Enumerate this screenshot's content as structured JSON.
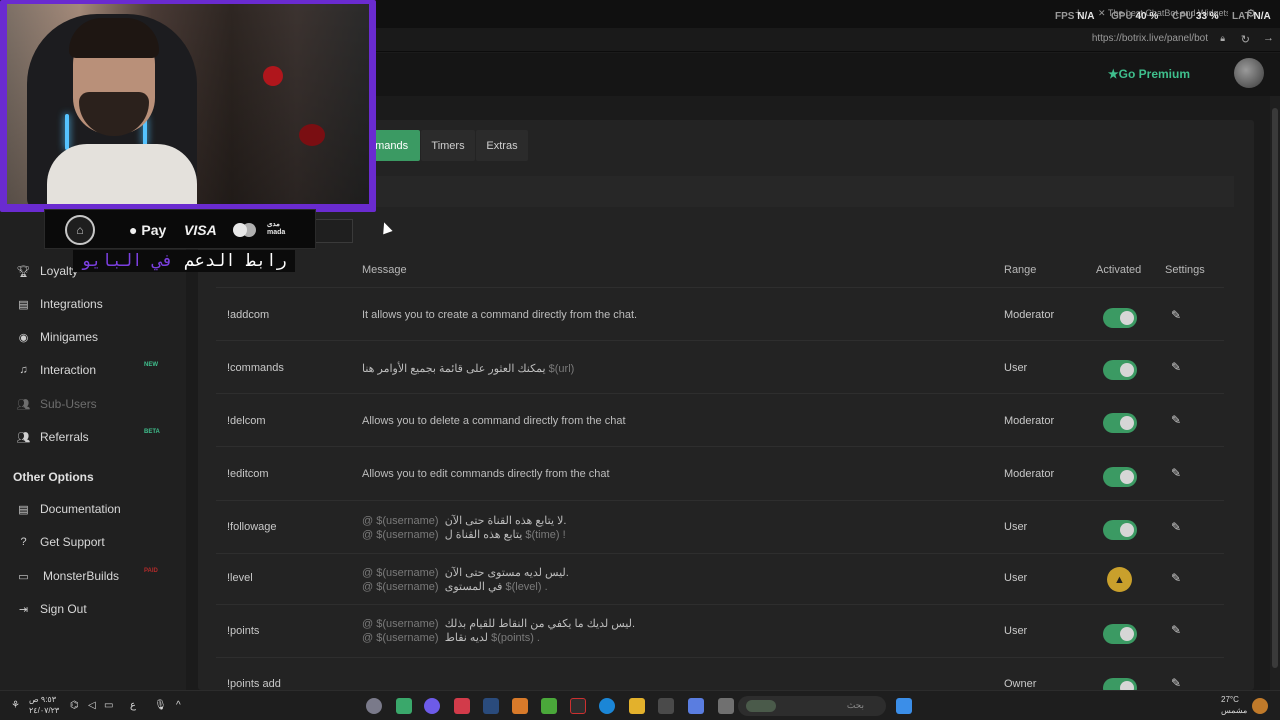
{
  "browser": {
    "tab_title": "The best ChatBot and Widgets fo",
    "url": "https://botrix.live/panel/bot",
    "stats": [
      {
        "label": "FPS",
        "value": "N/A"
      },
      {
        "label": "GPU",
        "value": "40 %"
      },
      {
        "label": "CPU",
        "value": "33 %"
      },
      {
        "label": "LAT",
        "value": "N/A"
      }
    ]
  },
  "header": {
    "go_premium": "Go Premium"
  },
  "sidebar": {
    "items": [
      {
        "label": "Loyalty",
        "icon": "trophy-icon"
      },
      {
        "label": "Integrations",
        "icon": "integrations-icon"
      },
      {
        "label": "Minigames",
        "icon": "gamepad-icon"
      },
      {
        "label": "Interaction",
        "icon": "music-icon",
        "badge": "NEW"
      },
      {
        "label": "Sub-Users",
        "icon": "users-icon"
      },
      {
        "label": "Referrals",
        "icon": "referrals-icon",
        "badge": "BETA"
      }
    ],
    "other_options_heading": "Other Options",
    "other_items": [
      {
        "label": "Documentation",
        "icon": "book-icon"
      },
      {
        "label": "Get Support",
        "icon": "help-icon"
      },
      {
        "label": "MonsterBuilds",
        "icon": "laptop-icon",
        "badge": "PAID"
      },
      {
        "label": "Sign Out",
        "icon": "sign-out-icon"
      }
    ]
  },
  "tabs": [
    {
      "label": "Commands",
      "active": true
    },
    {
      "label": "Timers",
      "active": false
    },
    {
      "label": "Extras",
      "active": false
    }
  ],
  "table": {
    "headers": {
      "message": "Message",
      "range": "Range",
      "activated": "Activated",
      "settings": "Settings"
    },
    "rows": [
      {
        "command": "!addcom",
        "message": "It allows you to create a command directly from the chat.",
        "range": "Moderator",
        "status": "on"
      },
      {
        "command": "!commands",
        "message": "يمكنك العثور على قائمة بجميع الأوامر هنا",
        "message_var": "$(url)",
        "range": "User",
        "status": "on"
      },
      {
        "command": "!delcom",
        "message": "Allows you to delete a command directly from the chat",
        "range": "Moderator",
        "status": "on"
      },
      {
        "command": "!editcom",
        "message": "Allows you to edit commands directly from the chat",
        "range": "Moderator",
        "status": "on"
      },
      {
        "command": "!followage",
        "line1_var": "@ $(username)",
        "line1": "لا يتابع هذه القناة حتى الآن.",
        "line2_var": "@ $(username)",
        "line2": "يتابع هذه القناة ل",
        "line2_tail": "$(time) !",
        "range": "User",
        "status": "on"
      },
      {
        "command": "!level",
        "line1_var": "@ $(username)",
        "line1": "ليس لديه مستوى حتى الآن.",
        "line2_var": "@ $(username)",
        "line2": "في المستوى",
        "line2_tail": "$(level) .",
        "range": "User",
        "status": "warning"
      },
      {
        "command": "!points",
        "line1_var": "@ $(username)",
        "line1": "ليس لديك ما يكفي من النقاط للقيام بذلك.",
        "line2_var": "@ $(username)",
        "line2": "لديه نقاط",
        "line2_tail": "$(points) .",
        "range": "User",
        "status": "on"
      },
      {
        "command": "!points add",
        "message": "",
        "range": "Owner",
        "status": "on"
      }
    ]
  },
  "overlay": {
    "payment_methods": [
      "Pay",
      "VISA"
    ],
    "mada_label": "مدى\nmada",
    "support_text_white": "رابط الدعم",
    "support_text_purple": "في البايو"
  },
  "taskbar": {
    "search_placeholder": "بحث",
    "weather_temp": "27°C",
    "weather_label": "مشمس",
    "clock_time": "٩:٥٣ ص",
    "clock_date": "٢٤/٠٧/٢٣"
  }
}
